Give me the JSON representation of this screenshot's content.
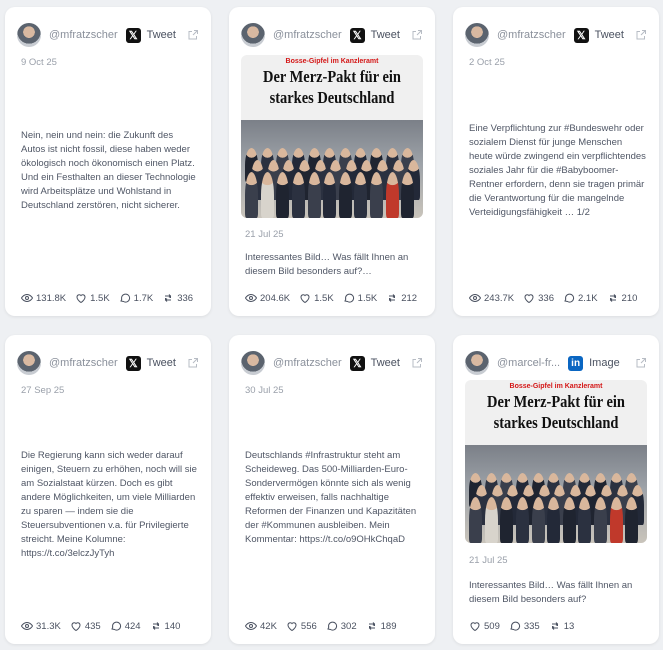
{
  "cards": [
    {
      "handle": "@mfratzscher",
      "platform": "Tweet",
      "platform_icon": "x-logo-icon",
      "date": "9 Oct 25",
      "text": "Nein, nein und nein: die Zukunft des Autos ist nicht fossil, diese haben weder ökologisch noch ökonomisch einen Platz. Und ein Festhalten an dieser Technologie wird Arbeitsplätze und Wohlstand in Deutschland zerstören, nicht sicherer.",
      "views": "131.8K",
      "likes": "1.5K",
      "replies": "1.7K",
      "reposts": "336"
    },
    {
      "handle": "@mfratzscher",
      "platform": "Tweet",
      "platform_icon": "x-logo-icon",
      "media_kicker": "Bosse-Gipfel im Kanzleramt",
      "media_headline_1": "Der Merz-Pakt für ein",
      "media_headline_2": "starkes Deutschland",
      "date": "21 Jul 25",
      "text": "Interessantes Bild… Was fällt Ihnen an diesem Bild besonders auf?…",
      "views": "204.6K",
      "likes": "1.5K",
      "replies": "1.5K",
      "reposts": "212"
    },
    {
      "handle": "@mfratzscher",
      "platform": "Tweet",
      "platform_icon": "x-logo-icon",
      "date": "2 Oct 25",
      "text": "Eine Verpflichtung zur #Bundeswehr oder sozialem Dienst für junge Menschen heute würde zwingend ein verpflichtendes soziales Jahr für die #Babyboomer-Rentner erfordern, denn sie tragen primär die Verantwortung für die mangelnde Verteidigungsfähigkeit … 1/2",
      "views": "243.7K",
      "likes": "336",
      "replies": "2.1K",
      "reposts": "210"
    },
    {
      "handle": "@mfratzscher",
      "platform": "Tweet",
      "platform_icon": "x-logo-icon",
      "date": "27 Sep 25",
      "text": "Die Regierung kann sich weder darauf einigen, Steuern zu erhöhen, noch will sie am Sozialstaat kürzen. Doch es gibt andere Möglichkeiten, um viele Milliarden zu sparen — indem sie die Steuersubventionen v.a. für Privilegierte streicht. Meine Kolumne: https://t.co/3elczJyTyh",
      "views": "31.3K",
      "likes": "435",
      "replies": "424",
      "reposts": "140"
    },
    {
      "handle": "@mfratzscher",
      "platform": "Tweet",
      "platform_icon": "x-logo-icon",
      "date": "30 Jul 25",
      "text": "Deutschlands #Infrastruktur steht am Scheideweg. Das 500-Milliarden-Euro-Sondervermögen könnte sich als wenig effektiv erweisen, falls nachhaltige Reformen der Finanzen und Kapazitäten der #Kommunen ausbleiben. Mein Kommentar: https://t.co/o9OHkChqaD",
      "views": "42K",
      "likes": "556",
      "replies": "302",
      "reposts": "189"
    },
    {
      "handle": "@marcel-fr...",
      "platform": "Image",
      "platform_icon": "linkedin-logo-icon",
      "media_kicker": "Bosse-Gipfel im Kanzleramt",
      "media_headline_1": "Der Merz-Pakt für ein",
      "media_headline_2": "starkes Deutschland",
      "date": "21 Jul 25",
      "text": "Interessantes Bild… Was fällt Ihnen an diesem Bild besonders auf?",
      "likes": "509",
      "replies": "335",
      "reposts": "13"
    }
  ],
  "colors": {
    "page_bg": "#eef0f3",
    "card_bg": "#ffffff",
    "x_logo": "#111111",
    "linkedin_logo": "#0a66c2",
    "headline_red": "#d41616"
  }
}
